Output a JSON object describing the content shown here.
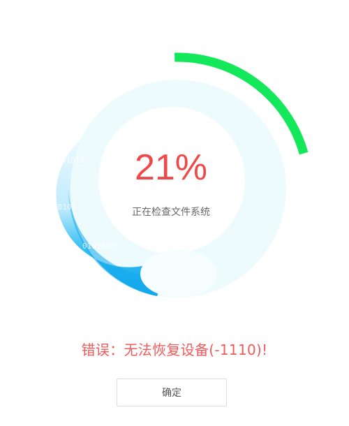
{
  "progress": {
    "percent_text": "21%",
    "value": 0.21,
    "status_text": "正在检查文件系统",
    "binary_labels": [
      "01010",
      "10101",
      "01010101"
    ]
  },
  "error": {
    "message": "错误：无法恢复设备(-1110)!"
  },
  "dialog": {
    "confirm_label": "确定"
  },
  "colors": {
    "progress_arc": "#12e85a",
    "ring_track": "#eefbfd",
    "water_top": "#e8f8fe",
    "water_bottom": "#12a8ec",
    "error_text": "#f05a5a",
    "percent_text": "#f04848"
  }
}
